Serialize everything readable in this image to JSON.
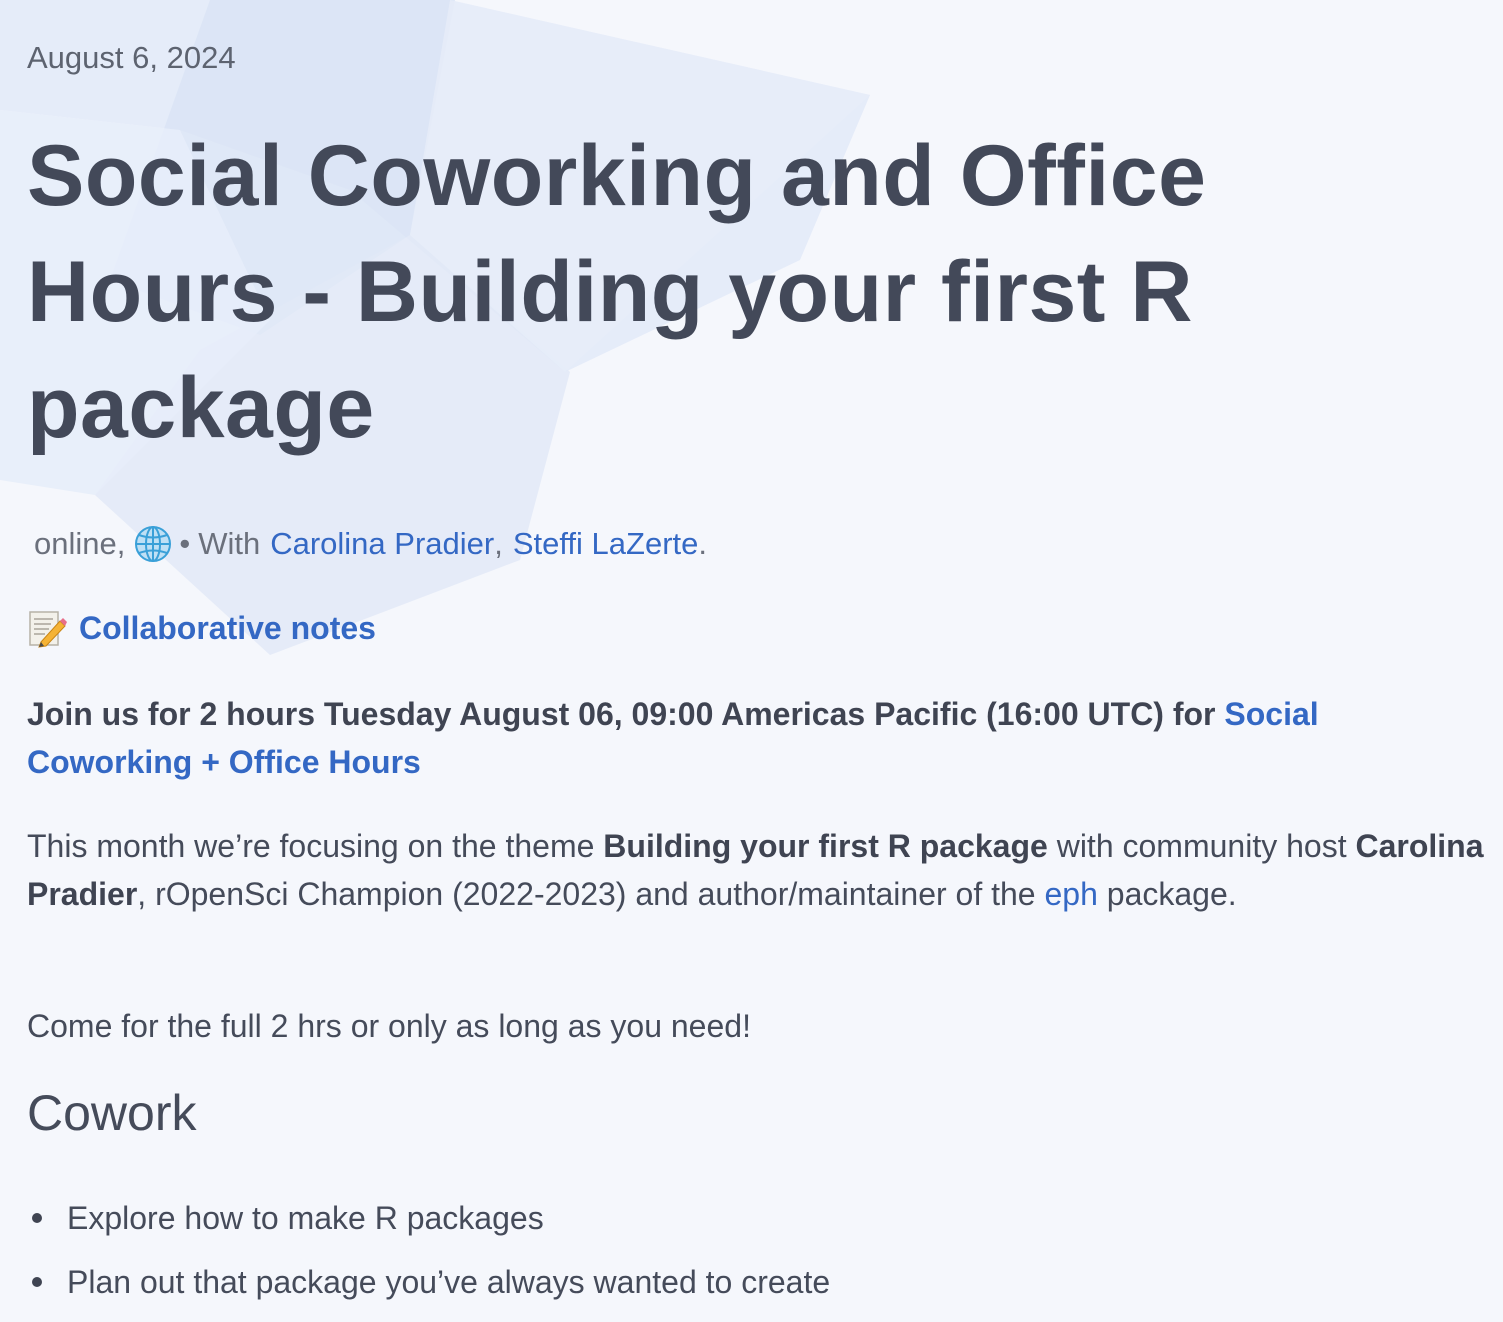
{
  "event": {
    "date": "August 6, 2024",
    "title": "Social Coworking and Office Hours - Building your first R package",
    "meta": {
      "location": "online,",
      "location_icon": "globe-icon",
      "separator": "•",
      "with_label": "With",
      "hosts": [
        "Carolina Pradier",
        "Steffi LaZerte"
      ],
      "comma": ",",
      "period": "."
    },
    "notes": {
      "icon": "memo-icon",
      "label": "Collaborative notes"
    },
    "join": {
      "text": "Join us for 2 hours Tuesday August 06, 09:00 Americas Pacific (16:00 UTC) for ",
      "link": "Social Coworking + Office Hours"
    },
    "description": {
      "part1": "This month we’re focusing on the theme ",
      "theme": "Building your first R package",
      "part2": " with community host ",
      "host": "Carolina Pradier",
      "part3": ", rOpenSci Champion (2022-2023) and author/maintainer of the ",
      "package_link": "eph",
      "part4": " package."
    },
    "come": "Come for the full 2 hrs or only as long as you need!",
    "cowork": {
      "heading": "Cowork",
      "items": [
        "Explore how to make R packages",
        "Plan out that package you’ve always wanted to create"
      ]
    }
  },
  "colors": {
    "background": "#f5f7fc",
    "text": "#454b5a",
    "link": "#3468c4",
    "shape": "#dfe7f6"
  }
}
